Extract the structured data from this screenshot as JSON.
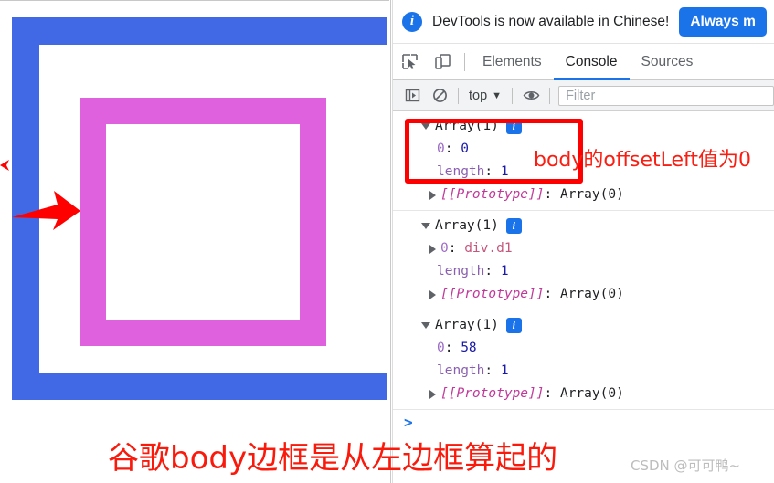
{
  "preview": {
    "body_box_color": "#4169e5",
    "d1_box_color": "#e061de",
    "arrow_color": "#ff0000",
    "arrow_big_name": "red-arrow-pointing-right",
    "arrow_small_name": "red-arrow-small-left"
  },
  "banner": {
    "icon": "info-icon",
    "text": "DevTools is now available in Chinese!",
    "button_label": "Always m"
  },
  "tabbar": {
    "inspect_icon": "inspect-element-icon",
    "device_icon": "device-toolbar-icon",
    "tabs": [
      {
        "label": "Elements",
        "active": false
      },
      {
        "label": "Console",
        "active": true
      },
      {
        "label": "Sources",
        "active": false
      }
    ]
  },
  "console_toolbar": {
    "sidebar_icon": "console-sidebar-icon",
    "clear_icon": "clear-console-icon",
    "context_value": "top",
    "context_caret": "▼",
    "eye_icon": "live-expression-eye-icon",
    "filter_placeholder": "Filter"
  },
  "console": {
    "groups": [
      {
        "header": "Array(1)",
        "badge": "i",
        "rows": [
          {
            "indent": 2,
            "arrow": "none",
            "key": "0",
            "key_class": "k-dim",
            "value": "0",
            "value_class": "k-num"
          },
          {
            "indent": 2,
            "arrow": "none",
            "key": "length",
            "key_class": "k-prop",
            "value": "1",
            "value_class": "k-num"
          },
          {
            "indent": 1,
            "arrow": "right",
            "key": "[[Prototype]]",
            "key_class": "k-proto",
            "value": "Array(0)",
            "value_class": "k-plain"
          }
        ]
      },
      {
        "header": "Array(1)",
        "badge": "i",
        "rows": [
          {
            "indent": 1,
            "arrow": "right",
            "key": "0",
            "key_class": "k-dim",
            "value": "div.d1",
            "value_class": "k-node"
          },
          {
            "indent": 2,
            "arrow": "none",
            "key": "length",
            "key_class": "k-prop",
            "value": "1",
            "value_class": "k-num"
          },
          {
            "indent": 1,
            "arrow": "right",
            "key": "[[Prototype]]",
            "key_class": "k-proto",
            "value": "Array(0)",
            "value_class": "k-plain"
          }
        ]
      },
      {
        "header": "Array(1)",
        "badge": "i",
        "rows": [
          {
            "indent": 2,
            "arrow": "none",
            "key": "0",
            "key_class": "k-dim",
            "value": "58",
            "value_class": "k-num"
          },
          {
            "indent": 2,
            "arrow": "none",
            "key": "length",
            "key_class": "k-prop",
            "value": "1",
            "value_class": "k-num"
          },
          {
            "indent": 1,
            "arrow": "right",
            "key": "[[Prototype]]",
            "key_class": "k-proto",
            "value": "Array(0)",
            "value_class": "k-plain"
          }
        ]
      }
    ],
    "prompt_caret": ">"
  },
  "annotations": {
    "red_box_color": "#ff0000",
    "note_text": "body的offsetLeft值为0",
    "caption_text": "谷歌body边框是从左边框算起的",
    "watermark_text": "CSDN @可可鸭~"
  }
}
